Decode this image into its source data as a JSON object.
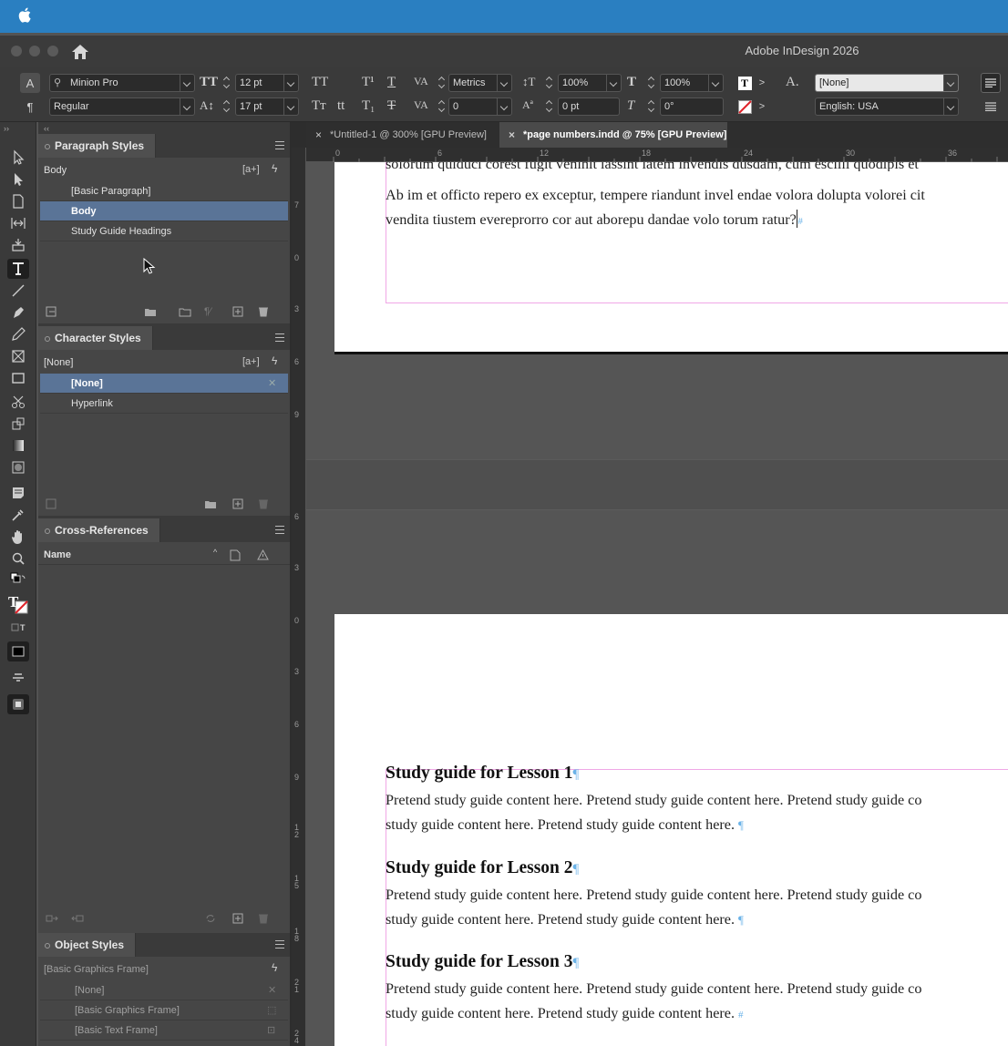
{
  "app": {
    "title": "Adobe InDesign 2026"
  },
  "control_panel": {
    "font_family": "Minion Pro",
    "font_style": "Regular",
    "font_size": "12 pt",
    "leading": "17 pt",
    "kerning": "Metrics",
    "tracking": "0",
    "vertical_scale": "100%",
    "horizontal_scale": "100%",
    "baseline_shift": "0 pt",
    "skew": "0°",
    "character_style": "[None]",
    "language": "English: USA"
  },
  "paragraph_styles": {
    "tab": "Paragraph Styles",
    "current": "Body",
    "items": [
      "[Basic Paragraph]",
      "Body",
      "Study Guide Headings"
    ],
    "selected": "Body"
  },
  "character_styles": {
    "tab": "Character Styles",
    "current": "[None]",
    "items": [
      "[None]",
      "Hyperlink"
    ],
    "selected": "[None]"
  },
  "cross_references": {
    "tab": "Cross-References",
    "column_name": "Name"
  },
  "object_styles": {
    "tab": "Object Styles",
    "current": "[Basic Graphics Frame]",
    "items": [
      "[None]",
      "[Basic Graphics Frame]",
      "[Basic Text Frame]"
    ]
  },
  "document_tabs": [
    {
      "label": "*Untitled-1 @ 300% [GPU Preview]",
      "active": false
    },
    {
      "label": "*page numbers.indd @ 75% [GPU Preview]",
      "active": true
    }
  ],
  "ruler_h": [
    "0",
    "6",
    "12",
    "18",
    "24",
    "30",
    "36"
  ],
  "ruler_v": [
    "5",
    "7",
    "6",
    "0",
    "6",
    "3",
    "6",
    "6",
    "6",
    "9",
    "6",
    "3",
    "0",
    "3",
    "6",
    "9",
    "1 2",
    "1 5",
    "1 8",
    "2 1",
    "2 4"
  ],
  "page1": {
    "line_partial": "solorum quiduci corest fugit venihit lassint latem invendis dusdam, cum escilli quodipis et",
    "line1": "Ab im et officto repero ex exceptur, tempere riandunt invel endae volora dolupta volorei cit",
    "line2": "vendita tiustem evereprorro cor aut aborepu dandae volo torum ratur?",
    "end_mark": "#"
  },
  "page2": {
    "lessons": [
      {
        "heading": "Study guide for Lesson 1",
        "line1": "Pretend study guide content here. Pretend study guide content here. Pretend study guide co",
        "line2": "study guide content here. Pretend study guide content here.",
        "heading_mark": "¶",
        "end_mark": "¶"
      },
      {
        "heading": "Study guide for Lesson 2",
        "line1": "Pretend study guide content here. Pretend study guide content here. Pretend study guide co",
        "line2": "study guide content here. Pretend study guide content here.",
        "heading_mark": "¶",
        "end_mark": "¶"
      },
      {
        "heading": "Study guide for Lesson 3",
        "line1": "Pretend study guide content here. Pretend study guide content here. Pretend study guide co",
        "line2": "study guide content here. Pretend study guide content here.",
        "heading_mark": "¶",
        "end_mark": "#"
      }
    ]
  },
  "colors": {
    "menubar": "#2a7fc1",
    "selection": "#5a7497",
    "frame_edge": "#f0a7e6",
    "hidden_chars": "#6bb3e8"
  }
}
